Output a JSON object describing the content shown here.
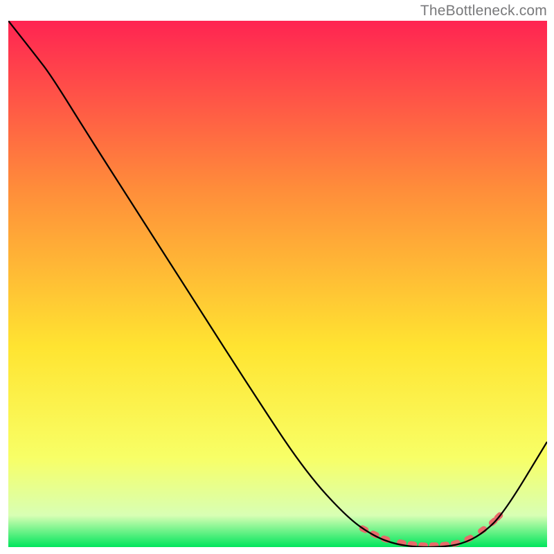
{
  "watermark": "TheBottleneck.com",
  "chart_data": {
    "type": "line",
    "title": "",
    "xlabel": "",
    "ylabel": "",
    "x": [
      0.0,
      0.05,
      0.08,
      0.15,
      0.25,
      0.35,
      0.45,
      0.55,
      0.63,
      0.68,
      0.72,
      0.76,
      0.8,
      0.84,
      0.88,
      0.92,
      1.0
    ],
    "values": [
      1.0,
      0.935,
      0.895,
      0.78,
      0.62,
      0.46,
      0.3,
      0.145,
      0.055,
      0.02,
      0.005,
      0.0,
      0.0,
      0.005,
      0.025,
      0.065,
      0.2
    ],
    "curve_region_x": [
      0.66,
      0.68,
      0.7,
      0.73,
      0.75,
      0.77,
      0.79,
      0.81,
      0.83,
      0.855,
      0.88,
      0.9,
      0.91
    ],
    "curve_region_y": [
      0.034,
      0.024,
      0.015,
      0.008,
      0.005,
      0.003,
      0.003,
      0.004,
      0.007,
      0.016,
      0.032,
      0.048,
      0.058
    ],
    "xlim": [
      0,
      1
    ],
    "ylim": [
      0,
      1
    ],
    "background_gradient": {
      "top": "#ff2452",
      "q1": "#ff8d3a",
      "mid": "#ffe431",
      "q3": "#f8ff66",
      "q90": "#d8ffb4",
      "bottom": "#00e55c"
    },
    "marker_color": "#e86a6a",
    "line_color": "#000000"
  }
}
